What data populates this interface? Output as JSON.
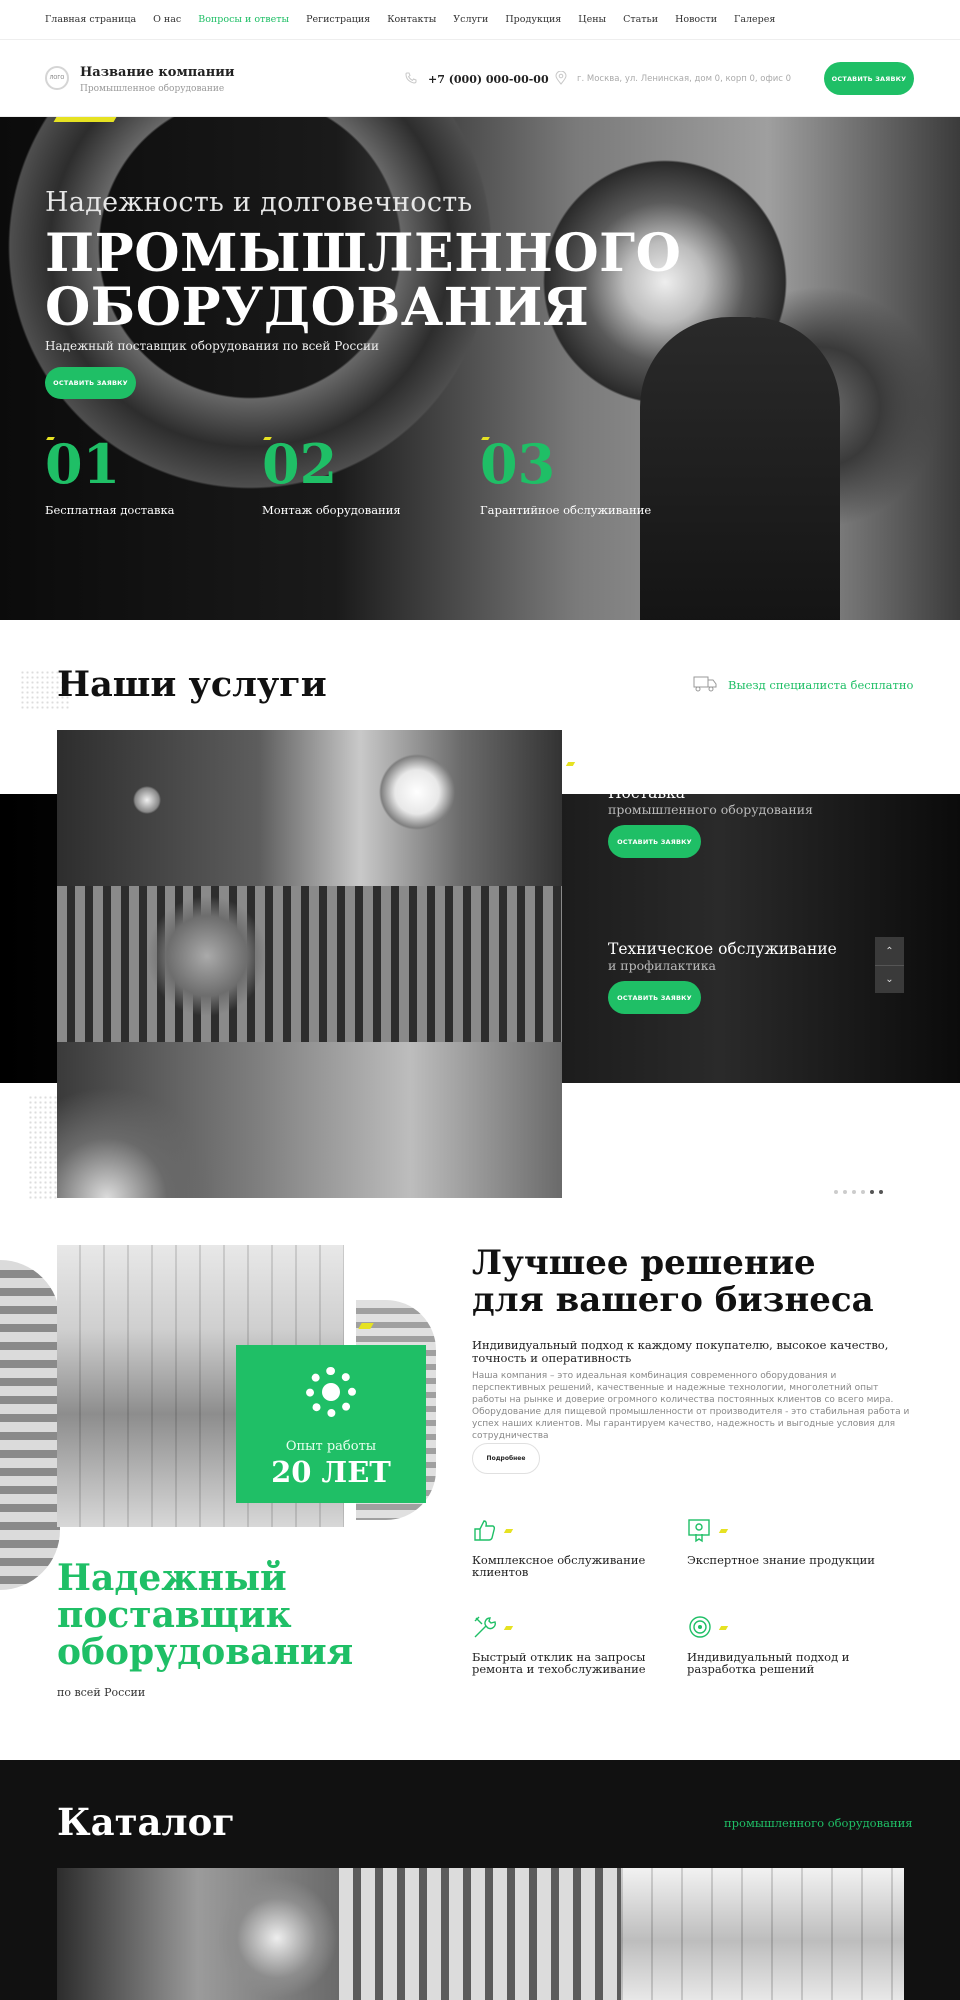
{
  "nav": {
    "items": [
      "Главная страница",
      "О нас",
      "Вопросы и ответы",
      "Регистрация",
      "Контакты",
      "Услуги",
      "Продукция",
      "Цены",
      "Статьи",
      "Новости",
      "Галерея"
    ],
    "active_index": 2
  },
  "header": {
    "logo_text": "ЛОГО",
    "company_name": "Название компании",
    "company_sub": "Промышленное оборудование",
    "phone": "+7 (000) 000-00-00",
    "address": "г. Москва, ул. Ленинская, дом 0, корп 0, офис 0",
    "cta": "Оставить заявку"
  },
  "hero": {
    "subtitle": "Надежность и долговечность",
    "title_line1": "ПРОМЫШЛЕННОГО",
    "title_line2": "ОБОРУДОВАНИЯ",
    "description": "Надежный поставщик оборудования по всей России",
    "cta": "Оставить заявку",
    "features": [
      {
        "num": "01",
        "label": "Бесплатная доставка"
      },
      {
        "num": "02",
        "label": "Монтаж оборудования"
      },
      {
        "num": "03",
        "label": "Гарантийное обслуживание"
      }
    ]
  },
  "services": {
    "title": "Наши услуги",
    "free_visit": "Выезд специалиста бесплатно",
    "items": [
      {
        "title": "Поставка",
        "subtitle": "промышленного оборудования",
        "cta": "Оставить заявку"
      },
      {
        "title": "Техническое обслуживание",
        "subtitle": "и профилактика",
        "cta": "Оставить заявку"
      }
    ],
    "arrow_up": "⌃",
    "arrow_down": "⌄"
  },
  "best": {
    "title_line1": "Лучшее решение",
    "title_line2": "для вашего бизнеса",
    "lead": "Индивидуальный подход к каждому покупателю, высокое качество, точность и оперативность",
    "text": "Наша компания – это идеальная комбинация современного оборудования и перспективных решений, качественные и надежные технологии, многолетний опыт работы на рынке и доверие огромного количества постоянных клиентов со всего мира. Оборудование для пищевой промышленности от производителя - это стабильная работа и успех наших клиентов. Мы гарантируем качество, надежность и выгодные условия для сотрудничества",
    "more": "Подробнее",
    "experience_label": "Опыт работы",
    "experience_value": "20 ЛЕТ",
    "advantages": [
      "Комплексное обслуживание клиентов",
      "Экспертное знание продукции",
      "Быстрый отклик на запросы ремонта и техобслуживание",
      "Индивидуальный подход и разработка решений"
    ],
    "supplier_line1": "Надежный",
    "supplier_line2": "поставщик",
    "supplier_line3": "оборудования",
    "supplier_sub": "по всей России"
  },
  "catalog": {
    "title": "Каталог",
    "subtitle": "промышленного оборудования"
  },
  "colors": {
    "accent": "#1fbf66",
    "highlight": "#e6e222",
    "dark": "#111111"
  }
}
